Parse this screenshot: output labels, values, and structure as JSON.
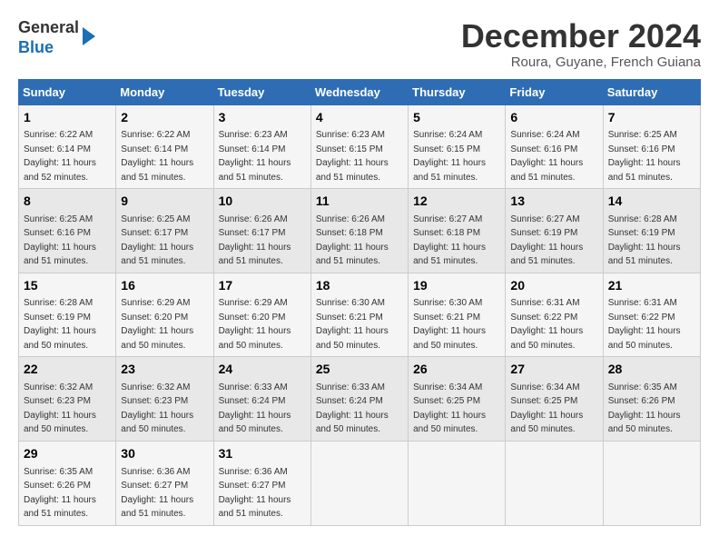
{
  "header": {
    "logo_general": "General",
    "logo_blue": "Blue",
    "month_title": "December 2024",
    "location": "Roura, Guyane, French Guiana"
  },
  "calendar": {
    "days_of_week": [
      "Sunday",
      "Monday",
      "Tuesday",
      "Wednesday",
      "Thursday",
      "Friday",
      "Saturday"
    ],
    "weeks": [
      [
        {
          "day": "",
          "info": ""
        },
        {
          "day": "",
          "info": ""
        },
        {
          "day": "",
          "info": ""
        },
        {
          "day": "",
          "info": ""
        },
        {
          "day": "",
          "info": ""
        },
        {
          "day": "",
          "info": ""
        },
        {
          "day": "",
          "info": ""
        }
      ]
    ]
  },
  "cells": [
    {
      "week": 0,
      "col": 6,
      "day": "1",
      "sunrise": "6:22 AM",
      "sunset": "6:14 PM",
      "daylight": "11 hours and 52 minutes."
    },
    {
      "week": 0,
      "col": 0,
      "day": "2",
      "sunrise": "6:22 AM",
      "sunset": "6:14 PM",
      "daylight": "11 hours and 51 minutes."
    },
    {
      "week": 1,
      "col": 1,
      "day": "3",
      "sunrise": "6:23 AM",
      "sunset": "6:14 PM",
      "daylight": "11 hours and 51 minutes."
    },
    {
      "week": 1,
      "col": 2,
      "day": "4",
      "sunrise": "6:23 AM",
      "sunset": "6:15 PM",
      "daylight": "11 hours and 51 minutes."
    },
    {
      "week": 1,
      "col": 3,
      "day": "5",
      "sunrise": "6:24 AM",
      "sunset": "6:15 PM",
      "daylight": "11 hours and 51 minutes."
    },
    {
      "week": 1,
      "col": 4,
      "day": "6",
      "sunrise": "6:24 AM",
      "sunset": "6:16 PM",
      "daylight": "11 hours and 51 minutes."
    },
    {
      "week": 1,
      "col": 5,
      "day": "7",
      "sunrise": "6:25 AM",
      "sunset": "6:16 PM",
      "daylight": "11 hours and 51 minutes."
    }
  ]
}
